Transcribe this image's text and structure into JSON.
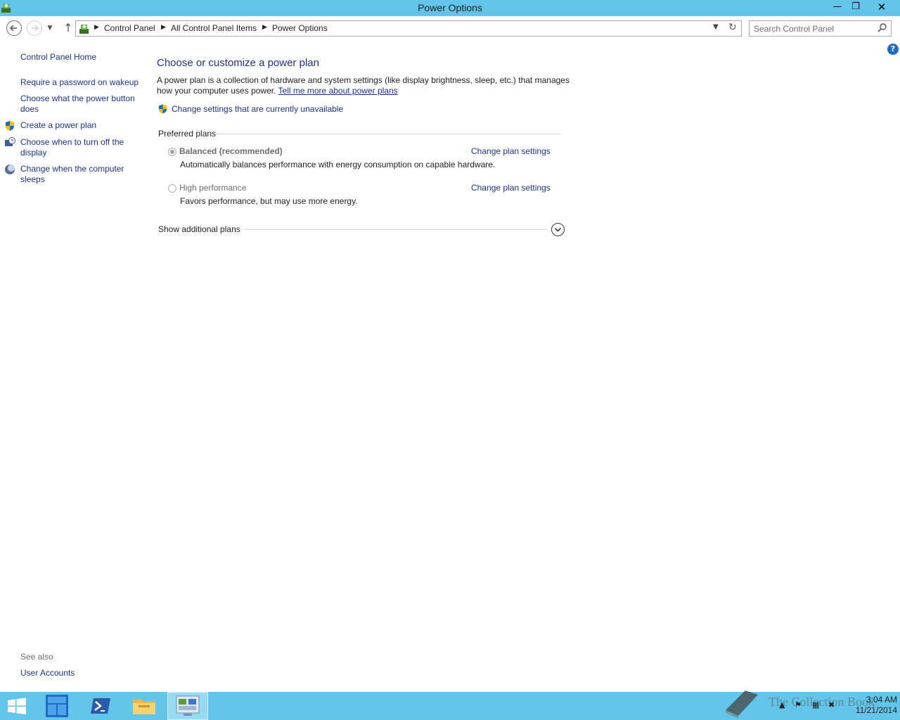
{
  "window": {
    "title": "Power Options",
    "minimize_label": "—",
    "maximize_label": "❐",
    "close_label": "✕"
  },
  "address_bar": {
    "path": [
      "Control Panel",
      "All Control Panel Items",
      "Power Options"
    ],
    "search_placeholder": "Search Control Panel"
  },
  "left_nav": {
    "home": "Control Panel Home",
    "items": [
      "Require a password on wakeup",
      "Choose what the power button does",
      "Create a power plan",
      "Choose when to turn off the display",
      "Change when the computer sleeps"
    ],
    "see_also_label": "See also",
    "see_also_items": [
      "User Accounts"
    ]
  },
  "main": {
    "title": "Choose or customize a power plan",
    "description": "A power plan is a collection of hardware and system settings (like display brightness, sleep, etc.) that manages how your computer uses power. ",
    "learn_more_link": "Tell me more about power plans",
    "admin_link": "Change settings that are currently unavailable",
    "preferred_plans_label": "Preferred plans",
    "plans": [
      {
        "name": "Balanced (recommended)",
        "description": "Automatically balances performance with energy consumption on capable hardware.",
        "change_label": "Change plan settings",
        "selected": true
      },
      {
        "name": "High performance",
        "description": "Favors performance, but may use more energy.",
        "change_label": "Change plan settings",
        "selected": false
      }
    ],
    "additional_plans_label": "Show additional plans"
  },
  "help_label": "?",
  "taskbar": {
    "clock_time": "3:04 AM",
    "clock_date": "11/21/2014",
    "watermark": "The Collection Book"
  },
  "colors": {
    "titlebar": "#62c6ea",
    "link": "#1e3287",
    "taskbar": "#62c6ea"
  }
}
